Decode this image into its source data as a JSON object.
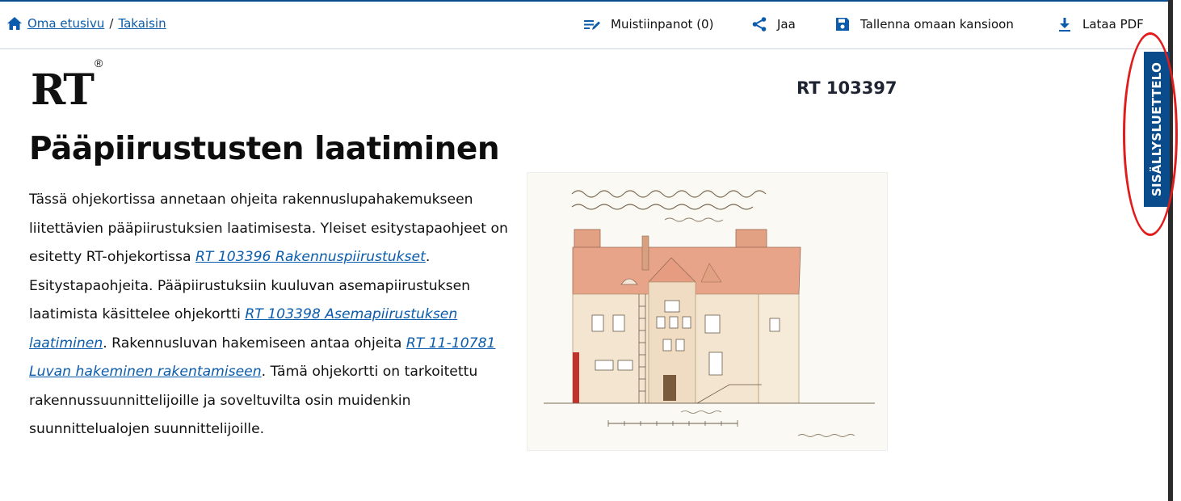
{
  "breadcrumb": {
    "home_label": "Oma etusivu",
    "separator": "/",
    "back_label": "Takaisin"
  },
  "toolbar": {
    "notes_label": "Muistiinpanot (0)",
    "share_label": "Jaa",
    "save_label": "Tallenna omaan kansioon",
    "download_label": "Lataa PDF"
  },
  "doc": {
    "logo_text": "RT",
    "logo_mark": "®",
    "code": "RT 103397",
    "title": "Pääpiirustusten laatiminen",
    "intro": {
      "t1": "Tässä ohjekortissa annetaan ohjeita rakennuslupahakemukseen liitettävien pääpiirustuksien laatimisesta. Yleiset esitystapaohjeet on esitetty RT-ohjekortissa ",
      "link1": "RT 103396 Rakennuspiirustukset",
      "t2": ". Esitystapaohjeita. Pääpiirustuksiin kuuluvan asemapiirustuksen laatimista käsittelee ohjekortti ",
      "link2": "RT 103398 Asemapiirustuksen laatiminen",
      "t3": ". Rakennusluvan hakemiseen antaa ohjeita ",
      "link3": "RT 11-10781 Luvan hakeminen rakentamiseen",
      "t4": ". Tämä ohjekortti on tarkoitettu rakennussuunnittelijoille ja soveltuvilta osin muidenkin suunnittelualojen suunnittelijoille."
    }
  },
  "toc": {
    "label": "SISÄLLYSLUETTELO"
  },
  "colors": {
    "accent": "#0a4c8b",
    "link": "#0b5cad",
    "highlight": "#e01c1c"
  }
}
